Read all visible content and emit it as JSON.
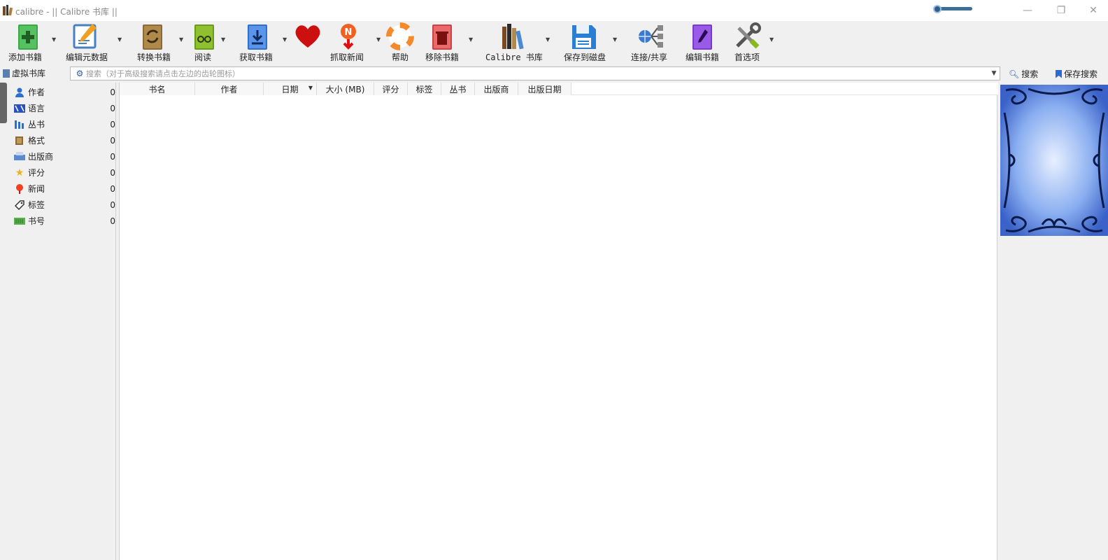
{
  "window": {
    "title": "calibre - || Calibre 书库 ||",
    "minimize_glyph": "—",
    "maximize_glyph": "❐",
    "close_glyph": "✕"
  },
  "toolbar": {
    "items": [
      {
        "label": "添加书籍",
        "icon": "add-book-icon",
        "has_menu": true
      },
      {
        "label": "编辑元数据",
        "icon": "edit-metadata-icon",
        "has_menu": true
      },
      {
        "label": "转换书籍",
        "icon": "convert-book-icon",
        "has_menu": true
      },
      {
        "label": "阅读",
        "icon": "read-book-icon",
        "has_menu": true
      },
      {
        "label": "获取书籍",
        "icon": "get-books-icon",
        "has_menu": true
      },
      {
        "label": "",
        "icon": "heart-icon",
        "has_menu": false
      },
      {
        "label": "抓取新闻",
        "icon": "fetch-news-icon",
        "has_menu": true
      },
      {
        "label": "帮助",
        "icon": "help-lifebuoy-icon",
        "has_menu": false
      },
      {
        "label": "移除书籍",
        "icon": "remove-book-icon",
        "has_menu": true
      },
      {
        "label": "Calibre 书库",
        "icon": "library-books-icon",
        "has_menu": true
      },
      {
        "label": "保存到磁盘",
        "icon": "save-disk-icon",
        "has_menu": true
      },
      {
        "label": "连接/共享",
        "icon": "connect-share-icon",
        "has_menu": false
      },
      {
        "label": "编辑书籍",
        "icon": "edit-book-icon",
        "has_menu": false
      },
      {
        "label": "首选项",
        "icon": "preferences-tools-icon",
        "has_menu": true
      }
    ]
  },
  "search": {
    "virtual_library_label": "虚拟书库",
    "placeholder": "搜索（对于高级搜索请点击左边的齿轮图标）",
    "search_button_label": "搜索",
    "save_search_label": "保存搜索"
  },
  "tag_browser": {
    "items": [
      {
        "name": "作者",
        "count": "0",
        "icon": "author-icon"
      },
      {
        "name": "语言",
        "count": "0",
        "icon": "language-icon"
      },
      {
        "name": "丛书",
        "count": "0",
        "icon": "series-icon"
      },
      {
        "name": "格式",
        "count": "0",
        "icon": "format-icon"
      },
      {
        "name": "出版商",
        "count": "0",
        "icon": "publisher-icon"
      },
      {
        "name": "评分",
        "count": "0",
        "icon": "rating-star-icon"
      },
      {
        "name": "新闻",
        "count": "0",
        "icon": "news-icon"
      },
      {
        "name": "标签",
        "count": "0",
        "icon": "tag-icon"
      },
      {
        "name": "书号",
        "count": "0",
        "icon": "identifier-icon"
      }
    ]
  },
  "book_list": {
    "columns": [
      "书名",
      "作者",
      "日期",
      "大小 (MB)",
      "评分",
      "标签",
      "丛书",
      "出版商",
      "出版日期"
    ],
    "sorted_column": "日期",
    "rows": []
  },
  "colors": {
    "accent": "#2c5ea8",
    "cover_blue": "#6f94e0"
  }
}
